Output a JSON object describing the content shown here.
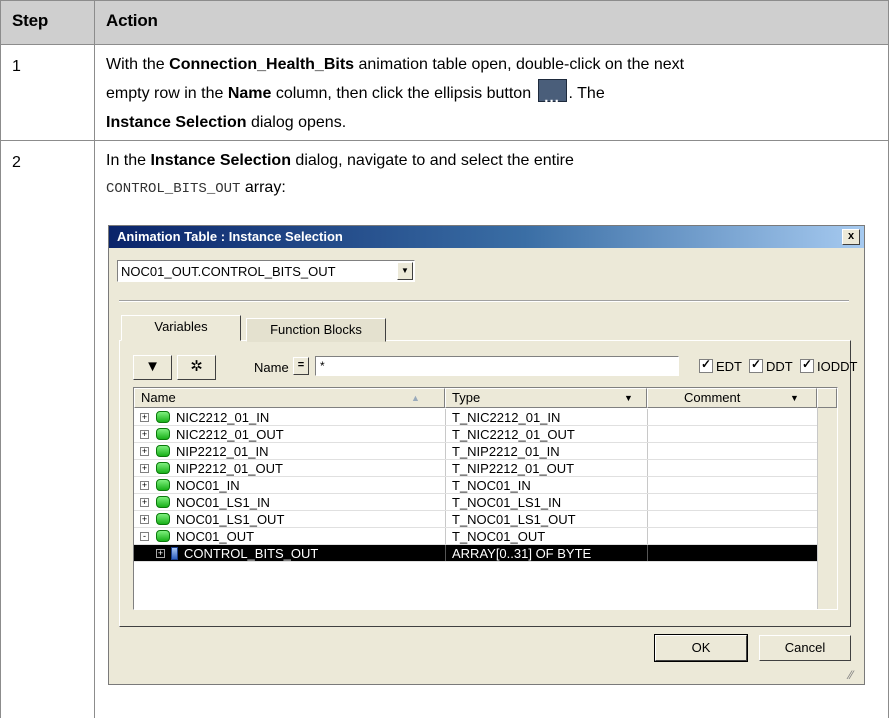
{
  "table": {
    "headers": {
      "step": "Step",
      "action": "Action"
    },
    "rows": [
      {
        "step": "1",
        "line1_pre": "With the ",
        "line1_b1": "Connection_Health_Bits",
        "line1_post": " animation table open, double-click on the next",
        "line2_pre": "empty row in the ",
        "line2_b1": "Name",
        "line2_post": " column, then click the ellipsis button ",
        "ellipsis_glyph": "...",
        "line2_end": ". The",
        "line3_b1": "Instance Selection",
        "line3_post": " dialog opens."
      },
      {
        "step": "2",
        "line1_pre": "In the ",
        "line1_b1": "Instance Selection",
        "line1_post": " dialog, navigate to and select the entire",
        "line2_mono": "CONTROL_BITS_OUT",
        "line2_post": " array:"
      }
    ]
  },
  "dialog": {
    "title": "Animation Table : Instance Selection",
    "close_glyph": "x",
    "combo_value": "NOC01_OUT.CONTROL_BITS_OUT",
    "tabs": [
      "Variables",
      "Function Blocks"
    ],
    "filter_label": "Name",
    "eq_glyph": "=",
    "filter_value": "*",
    "checks": [
      {
        "label": "EDT",
        "checked": true
      },
      {
        "label": "DDT",
        "checked": true
      },
      {
        "label": "IODDT",
        "checked": true
      }
    ],
    "columns": {
      "name": "Name",
      "type": "Type",
      "comment": "Comment"
    },
    "rows": [
      {
        "name": "NIC2212_01_IN",
        "type": "T_NIC2212_01_IN",
        "expander": "+"
      },
      {
        "name": "NIC2212_01_OUT",
        "type": "T_NIC2212_01_OUT",
        "expander": "+"
      },
      {
        "name": "NIP2212_01_IN",
        "type": "T_NIP2212_01_IN",
        "expander": "+"
      },
      {
        "name": "NIP2212_01_OUT",
        "type": "T_NIP2212_01_OUT",
        "expander": "+"
      },
      {
        "name": "NOC01_IN",
        "type": "T_NOC01_IN",
        "expander": "+"
      },
      {
        "name": "NOC01_LS1_IN",
        "type": "T_NOC01_LS1_IN",
        "expander": "+"
      },
      {
        "name": "NOC01_LS1_OUT",
        "type": "T_NOC01_LS1_OUT",
        "expander": "+"
      },
      {
        "name": "NOC01_OUT",
        "type": "T_NOC01_OUT",
        "expander": "-"
      },
      {
        "name": "CONTROL_BITS_OUT",
        "type": "ARRAY[0..31] OF BYTE",
        "expander": "+",
        "selected": true,
        "child": true
      }
    ],
    "ok_label": "OK",
    "cancel_label": "Cancel"
  }
}
